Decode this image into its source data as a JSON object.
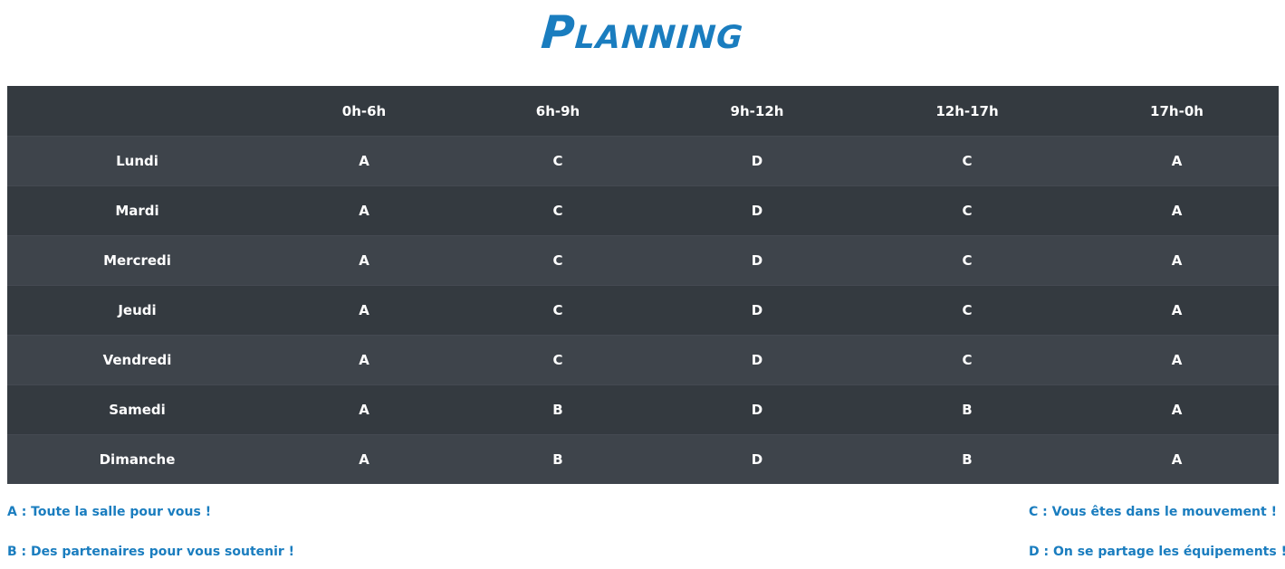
{
  "page": {
    "title": "Planning"
  },
  "table": {
    "headers": [
      "",
      "0h-6h",
      "6h-9h",
      "9h-12h",
      "12h-17h",
      "17h-0h"
    ],
    "rows": [
      {
        "day": "Lundi",
        "cells": [
          "A",
          "C",
          "D",
          "C",
          "A"
        ]
      },
      {
        "day": "Mardi",
        "cells": [
          "A",
          "C",
          "D",
          "C",
          "A"
        ]
      },
      {
        "day": "Mercredi",
        "cells": [
          "A",
          "C",
          "D",
          "C",
          "A"
        ]
      },
      {
        "day": "Jeudi",
        "cells": [
          "A",
          "C",
          "D",
          "C",
          "A"
        ]
      },
      {
        "day": "Vendredi",
        "cells": [
          "A",
          "C",
          "D",
          "C",
          "A"
        ]
      },
      {
        "day": "Samedi",
        "cells": [
          "A",
          "B",
          "D",
          "B",
          "A"
        ]
      },
      {
        "day": "Dimanche",
        "cells": [
          "A",
          "B",
          "D",
          "B",
          "A"
        ]
      }
    ]
  },
  "legend": {
    "a": "A : Toute la salle pour vous !",
    "b": "B : Des partenaires pour vous soutenir !",
    "c": "C : Vous êtes dans le mouvement !",
    "d": "D : On se partage les équipements !"
  },
  "colors": {
    "accent": "#1a7dbf",
    "header_bg": "#343a40",
    "row_odd_bg": "#3e444b",
    "row_even_bg": "#343a40",
    "cell_text": "#ffffff"
  }
}
